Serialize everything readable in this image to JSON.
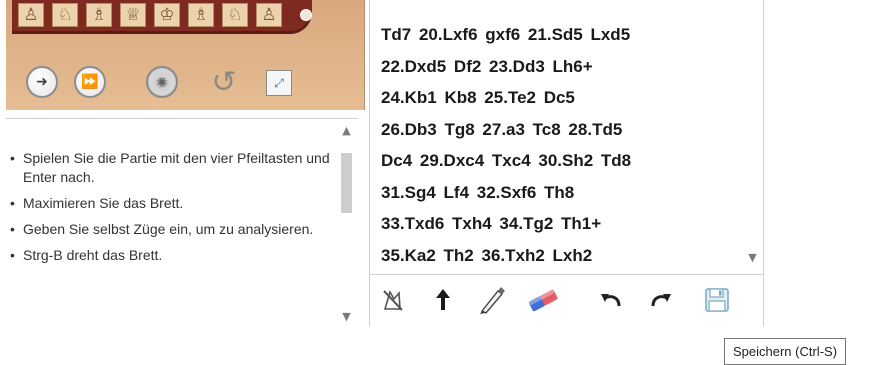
{
  "board": {
    "piece_icons": [
      "♙",
      "♘",
      "♗",
      "♕",
      "♔",
      "♗",
      "♘",
      "♙"
    ]
  },
  "controls": {
    "next_icon": "➜",
    "fast_forward_icon": "⏩",
    "wheel_icon": "✺",
    "reset_icon": "↺",
    "fullscreen_icon": "⤢"
  },
  "hints": [
    "Spielen Sie die Partie mit den vier Pfeiltasten und Enter nach.",
    "Maximieren Sie das Brett.",
    "Geben Sie selbst Züge ein, um zu analysieren.",
    "Strg-B dreht das Brett."
  ],
  "moves": [
    "Td7 20.Lxf6 gxf6 21.Sd5 Lxd5",
    "22.Dxd5 Df2 23.Dd3 Lh6+",
    "24.Kb1 Kb8 25.Te2 Dc5",
    "26.Db3 Tg8 27.a3 Tc8 28.Td5",
    "Dc4 29.Dxc4 Txc4 30.Sh2 Td8",
    "31.Sg4 Lf4 32.Sxf6 Th8",
    "33.Txd6 Txh4 34.Tg2 Th1+",
    "35.Ka2 Th2 36.Txh2 Lxh2"
  ],
  "toolbar": {
    "icons": [
      "delete-move-icon",
      "promote-variation-icon",
      "annotate-pen-icon",
      "eraser-icon",
      "undo-icon",
      "redo-icon",
      "save-icon"
    ]
  },
  "tooltip": {
    "text": "Speichern (Ctrl-S)"
  },
  "colors": {
    "board_frame": "#7e2a20",
    "panel_wood": "#e1b48a",
    "accent_blue": "#2f6fd6"
  }
}
